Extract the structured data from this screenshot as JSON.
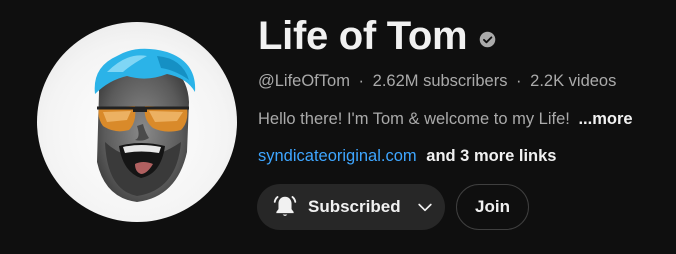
{
  "channel": {
    "title": "Life of Tom",
    "verified_icon": "verified-check-icon",
    "handle": "@LifeOfTom",
    "separator": "·",
    "subscribers": "2.62M subscribers",
    "videos": "2.2K videos",
    "description": "Hello there! I'm Tom & welcome to my Life!",
    "description_more": "...more",
    "link_text": "syndicateoriginal.com",
    "more_links": "and 3 more links"
  },
  "actions": {
    "subscribed_label": "Subscribed",
    "subscribed_icon": "bell-icon",
    "dropdown_icon": "chevron-down-icon",
    "join_label": "Join"
  },
  "colors": {
    "background": "#0f0f0f",
    "link": "#3ea6ff",
    "secondary_text": "#aaaaaa",
    "button_bg": "#272727",
    "hair": "#2bb3e8"
  }
}
